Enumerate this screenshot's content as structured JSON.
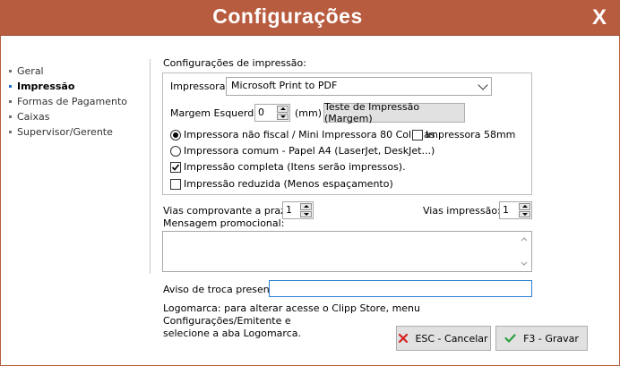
{
  "window": {
    "title": "Configurações",
    "close_label": "X"
  },
  "nav": {
    "items": [
      {
        "label": "Geral",
        "active": false
      },
      {
        "label": "Impressão",
        "active": true
      },
      {
        "label": "Formas de Pagamento",
        "active": false
      },
      {
        "label": "Caixas",
        "active": false
      },
      {
        "label": "Supervisor/Gerente",
        "active": false
      }
    ]
  },
  "print": {
    "section_label": "Configurações de impressão:",
    "printer_label": "Impressora:",
    "printer_value": "Microsoft Print to PDF",
    "margin_label": "Margem Esquerda:",
    "margin_value": "0",
    "margin_unit": "(mm)",
    "test_button": "Teste de Impressão (Margem)",
    "radio_non_fiscal": "Impressora não fiscal / Mini Impressora 80 Colunas",
    "check_58mm": "Impressora 58mm",
    "radio_common": "Impressora comum - Papel A4 (LaserJet, DeskJet...)",
    "check_full": "Impressão completa (Itens  serão impressos).",
    "check_reduced": "Impressão reduzida (Menos espaçamento)"
  },
  "copies": {
    "installment_label": "Vias comprovante a prazo:",
    "installment_value": "1",
    "print_label": "Vias impressão:",
    "print_value": "1"
  },
  "promo": {
    "label": "Mensagem promocional:",
    "value": ""
  },
  "gift": {
    "label": "Aviso de troca presente",
    "value": ""
  },
  "logo_note": {
    "line1": "Logomarca: para alterar acesse o Clipp Store, menu Configurações/Emitente e",
    "line2": "selecione a aba Logomarca."
  },
  "buttons": {
    "cancel": "ESC - Cancelar",
    "save": "F3 - Gravar"
  },
  "colors": {
    "titlebar": "#b85c40",
    "accent": "#1a6fd1",
    "cancel_icon": "#d42020",
    "save_icon": "#2e9e3e"
  }
}
